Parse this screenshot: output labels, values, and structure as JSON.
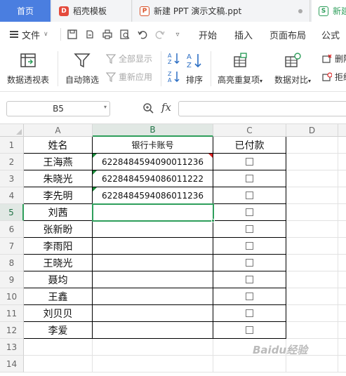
{
  "tabs": [
    {
      "label": "首页"
    },
    {
      "label": "稻壳模板",
      "icon": "daoke-logo-icon"
    },
    {
      "label": "新建 PPT 演示文稿.ppt",
      "icon": "ppt-file-icon"
    },
    {
      "label": "新建",
      "icon": "spreadsheet-file-icon"
    }
  ],
  "menu": {
    "file": "文件",
    "items": [
      "开始",
      "插入",
      "页面布局",
      "公式"
    ]
  },
  "ribbon": {
    "pivot": "数据透视表",
    "autofilter": "自动筛选",
    "showall": "全部显示",
    "reapply": "重新应用",
    "sort": "排序",
    "highlight_dup": "高亮重复项",
    "compare": "数据对比",
    "delete_dup": "删除",
    "reject_dup": "拒绝"
  },
  "formula_bar": {
    "cell_ref": "B5",
    "fx": "fx",
    "value": ""
  },
  "sheet": {
    "columns": [
      "A",
      "B",
      "C",
      "D"
    ],
    "row_numbers": [
      "1",
      "2",
      "3",
      "4",
      "5",
      "6",
      "7",
      "8",
      "9",
      "10",
      "11",
      "12",
      "13",
      "14"
    ],
    "header": {
      "name": "姓名",
      "account": "银行卡账号",
      "paid": "已付款"
    },
    "rows": [
      {
        "name": "王海燕",
        "account": "6228484594090011236"
      },
      {
        "name": "朱晓光",
        "account": "6228484594086011222"
      },
      {
        "name": "李先明",
        "account": "6228484594086011236"
      },
      {
        "name": "刘茜",
        "account": ""
      },
      {
        "name": "张新盼",
        "account": ""
      },
      {
        "name": "李雨阳",
        "account": ""
      },
      {
        "name": "王晓光",
        "account": ""
      },
      {
        "name": "聂均",
        "account": ""
      },
      {
        "name": "王鑫",
        "account": ""
      },
      {
        "name": "刘贝贝",
        "account": ""
      },
      {
        "name": "李爱",
        "account": ""
      }
    ]
  },
  "colors": {
    "accent_green": "#2e9e5b",
    "home_tab": "#4a7ee0"
  },
  "watermark": "Baidu经验"
}
